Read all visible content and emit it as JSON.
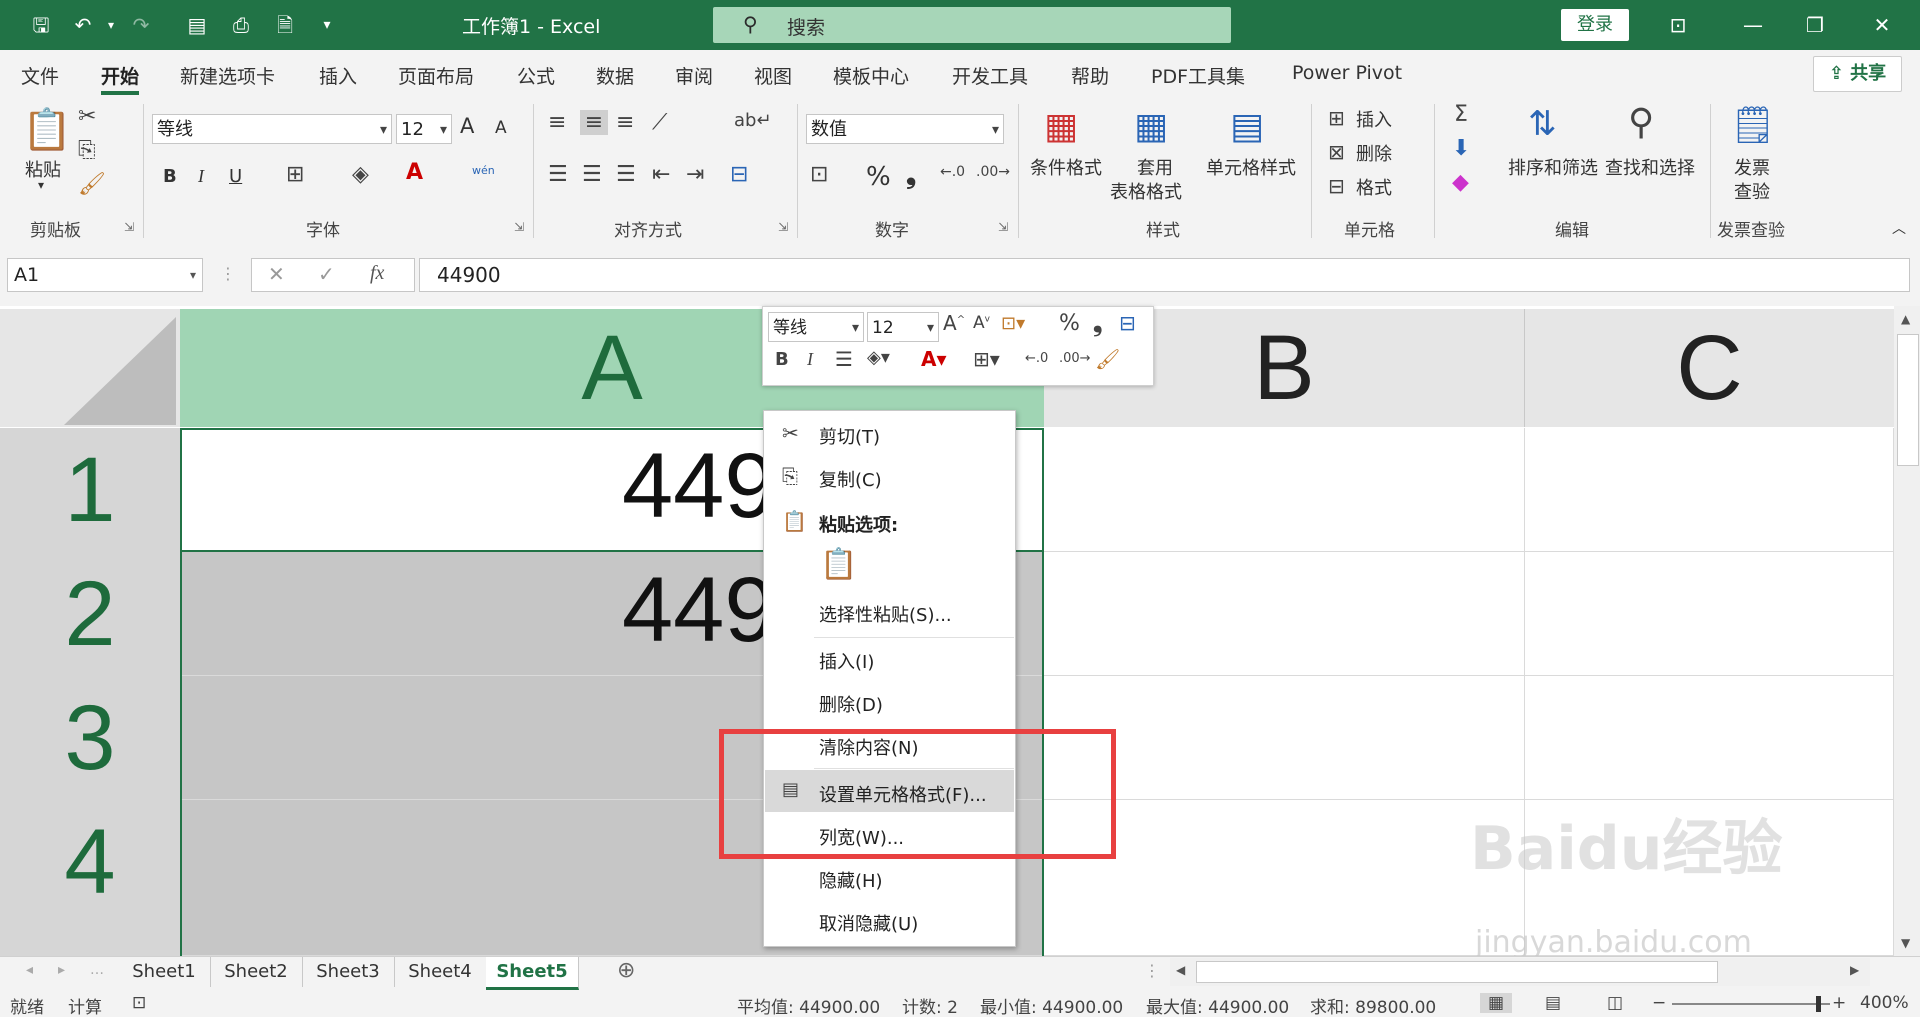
{
  "titlebar": {
    "doc_title": "工作簿1  -  Excel",
    "search_placeholder": "搜索",
    "login": "登录",
    "bg_color": "#217346"
  },
  "menu": {
    "items": [
      "文件",
      "开始",
      "新建选项卡",
      "插入",
      "页面布局",
      "公式",
      "数据",
      "审阅",
      "视图",
      "模板中心",
      "开发工具",
      "帮助",
      "PDF工具集",
      "Power Pivot"
    ],
    "active": "开始",
    "share": "共享"
  },
  "ribbon": {
    "clipboard": {
      "paste": "粘贴",
      "label": "剪贴板"
    },
    "font": {
      "name": "等线",
      "size": "12",
      "label": "字体",
      "bold": "B",
      "italic": "I",
      "underline": "U",
      "grow": "A",
      "shrink": "A",
      "phonetic": "wén"
    },
    "alignment": {
      "label": "对齐方式"
    },
    "number": {
      "format": "数值",
      "label": "数字",
      "percent": "%",
      "comma": "❟"
    },
    "styles": {
      "conditional": "条件格式",
      "table_line1": "套用",
      "table_line2": "表格格式",
      "cell_styles": "单元格样式",
      "label": "样式"
    },
    "cells": {
      "insert": "插入",
      "delete": "删除",
      "format": "格式",
      "label": "单元格"
    },
    "editing": {
      "sort": "排序和筛选",
      "find": "查找和选择",
      "label": "编辑"
    },
    "invoice": {
      "line1": "发票",
      "line2": "查验",
      "label": "发票查验"
    }
  },
  "formula_bar": {
    "name_box": "A1",
    "fx": "fx",
    "value": "44900"
  },
  "grid": {
    "columns": [
      "A",
      "B",
      "C"
    ],
    "rows": [
      "1",
      "2",
      "3",
      "4"
    ],
    "cells": {
      "A1": "449",
      "A2": "449"
    }
  },
  "mini_toolbar": {
    "font": "等线",
    "size": "12"
  },
  "context_menu": {
    "cut": "剪切(T)",
    "copy": "复制(C)",
    "paste_options": "粘贴选项:",
    "paste_special": "选择性粘贴(S)...",
    "insert": "插入(I)",
    "delete": "删除(D)",
    "clear": "清除内容(N)",
    "format_cells": "设置单元格格式(F)...",
    "col_width": "列宽(W)...",
    "hide": "隐藏(H)",
    "unhide": "取消隐藏(U)"
  },
  "sheets": {
    "tabs": [
      "Sheet1",
      "Sheet2",
      "Sheet3",
      "Sheet4",
      "Sheet5"
    ],
    "active": "Sheet5"
  },
  "status": {
    "ready": "就绪",
    "calc": "计算",
    "average": "平均值: 44900.00",
    "count": "计数: 2",
    "min": "最小值: 44900.00",
    "max": "最大值: 44900.00",
    "sum": "求和: 89800.00",
    "zoom": "400%"
  },
  "watermark": {
    "main": "Baidu经验",
    "url": "jingyan.baidu.com"
  }
}
